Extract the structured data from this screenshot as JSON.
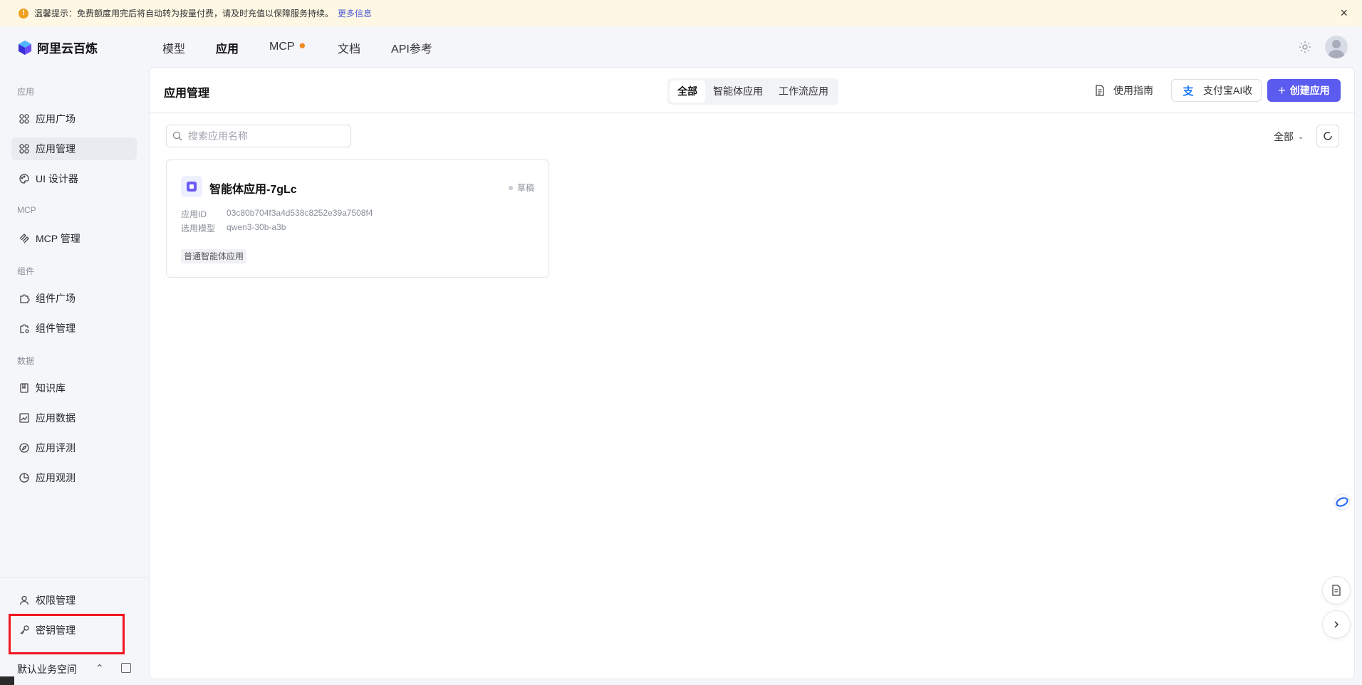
{
  "notice": {
    "text": "温馨提示：免费额度用完后将自动转为按量付费，请及时充值以保障服务持续。",
    "link": "更多信息"
  },
  "brand": {
    "name": "阿里云百炼"
  },
  "topnav": {
    "items": [
      {
        "label": "模型"
      },
      {
        "label": "应用"
      },
      {
        "label": "MCP"
      },
      {
        "label": "文档"
      },
      {
        "label": "API参考"
      }
    ],
    "active": "应用"
  },
  "sidebar": {
    "groups": {
      "app": "应用",
      "mcp": "MCP",
      "component": "组件",
      "data": "数据"
    },
    "items": {
      "app_square": "应用广场",
      "app_manage": "应用管理",
      "ui_designer": "UI 设计器",
      "mcp_manage": "MCP 管理",
      "component_square": "组件广场",
      "component_manage": "组件管理",
      "knowledge": "知识库",
      "app_data": "应用数据",
      "app_eval": "应用评测",
      "app_observe": "应用观测",
      "permission": "权限管理",
      "key_manage": "密钥管理"
    },
    "selected": "应用管理",
    "workspace": "默认业务空间"
  },
  "main": {
    "title": "应用管理",
    "segments": [
      "全部",
      "智能体应用",
      "工作流应用"
    ],
    "active_segment": "全部",
    "guide_label": "使用指南",
    "alipay_label": "支付宝AI收",
    "create_label": "创建应用",
    "search_placeholder": "搜索应用名称",
    "filter_label": "全部"
  },
  "cards": [
    {
      "name": "智能体应用-7gLc",
      "status": "草稿",
      "id_label": "应用ID",
      "id_value": "03c80b704f3a4d538c8252e39a7508f4",
      "model_label": "选用模型",
      "model_value": "qwen3-30b-a3b",
      "tag": "普通智能体应用"
    }
  ],
  "colors": {
    "primary": "#5b5bf0",
    "notice_bg": "#fdf7e3",
    "highlight": "#f0141e"
  }
}
